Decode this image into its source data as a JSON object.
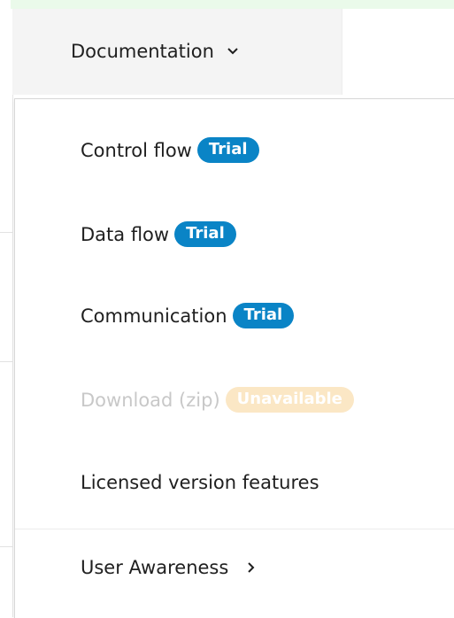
{
  "nav": {
    "documentation_label": "Documentation"
  },
  "menu": {
    "items": [
      {
        "label": "Control flow",
        "badge": "Trial"
      },
      {
        "label": "Data flow",
        "badge": "Trial"
      },
      {
        "label": "Communication",
        "badge": "Trial"
      },
      {
        "label": "Download (zip)",
        "badge": "Unavailable"
      },
      {
        "label": "Licensed version features"
      },
      {
        "label": "User Awareness"
      }
    ]
  },
  "colors": {
    "trial_badge": "#0a84c6",
    "unavailable_badge": "#fbe7c5",
    "nav_bg": "#f4f4f4"
  },
  "icons": {
    "documentation_chevron": "chevron-down-icon",
    "user_awareness_chevron": "chevron-right-icon"
  }
}
